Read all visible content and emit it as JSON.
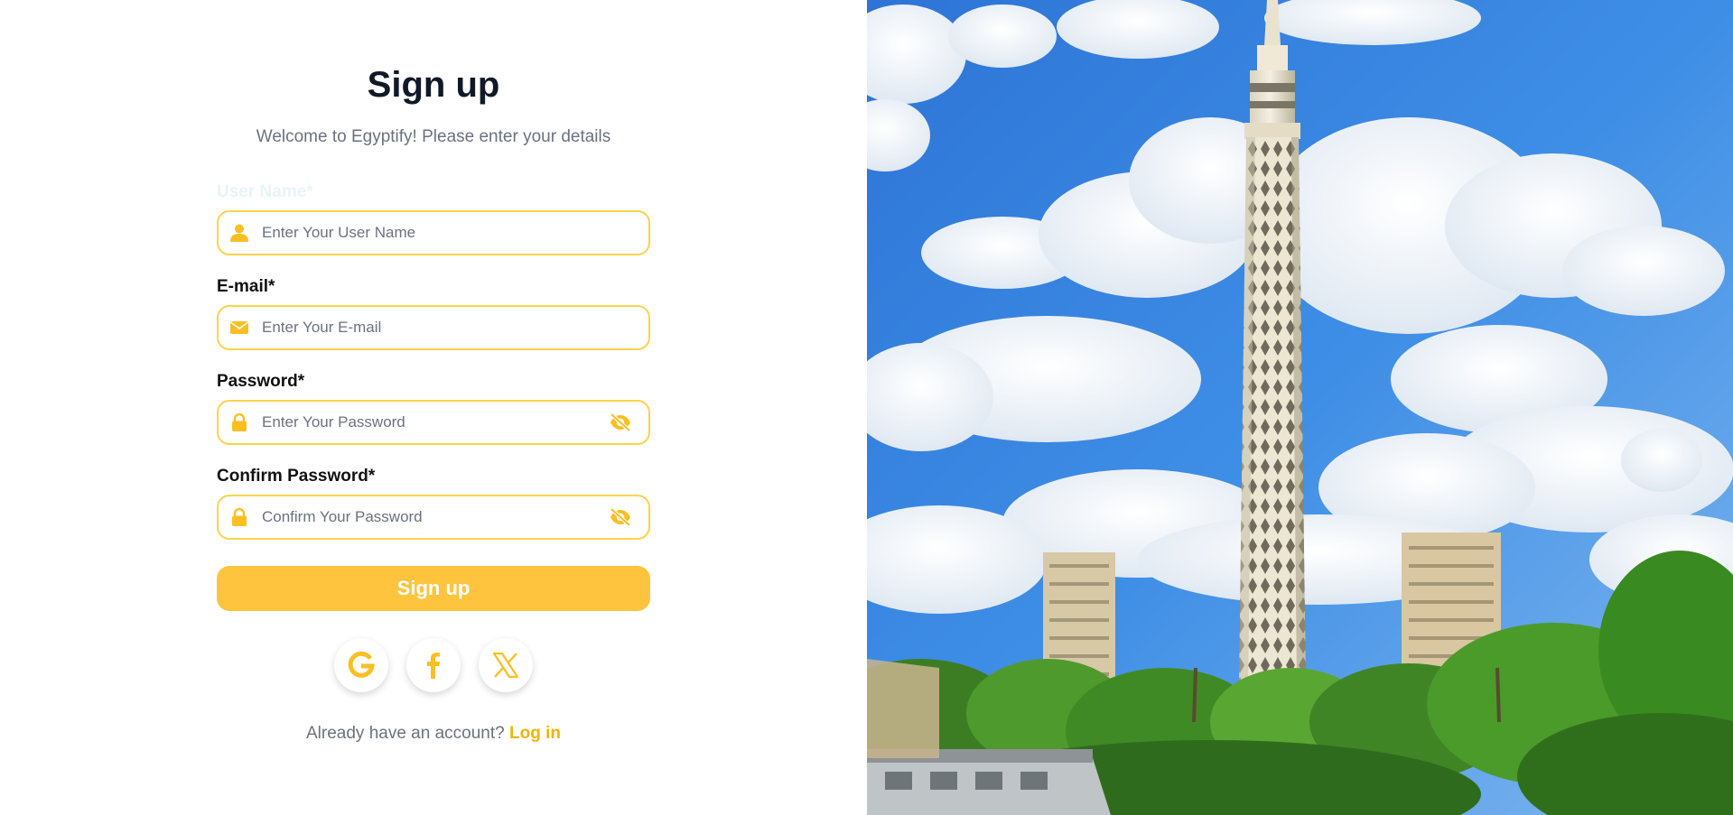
{
  "form": {
    "title": "Sign up",
    "subtitle": "Welcome to Egyptify! Please enter your details",
    "username": {
      "label": "User Name*",
      "placeholder": "Enter Your User Name",
      "icon": "user-icon"
    },
    "email": {
      "label": "E-mail*",
      "placeholder": "Enter Your E-mail",
      "icon": "envelope-icon"
    },
    "password": {
      "label": "Password*",
      "placeholder": "Enter Your Password",
      "icon": "lock-icon",
      "toggle_icon": "eye-slash-icon"
    },
    "confirm_password": {
      "label": "Confirm Password*",
      "placeholder": "Confirm Your Password",
      "icon": "lock-icon",
      "toggle_icon": "eye-slash-icon"
    },
    "submit_label": "Sign up"
  },
  "social": [
    {
      "name": "google-icon"
    },
    {
      "name": "facebook-icon"
    },
    {
      "name": "x-icon"
    }
  ],
  "footer": {
    "prompt": "Already have an account?",
    "link": "Log in"
  },
  "hero_image": {
    "subject": "cairo-tower-photo"
  },
  "colors": {
    "accent": "#ffc43d",
    "field_border": "#fcd34d",
    "icon": "#fbbf24",
    "link": "#f4b400",
    "title": "#111827",
    "muted": "#6b7280"
  }
}
